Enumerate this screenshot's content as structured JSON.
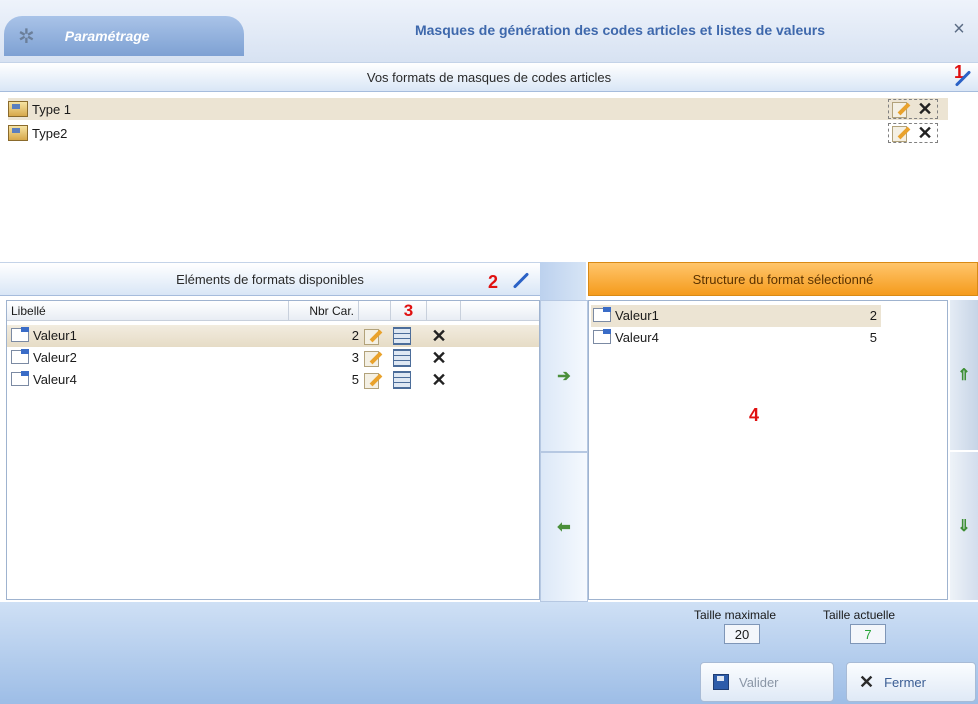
{
  "titlebar": {
    "tab_label": "Paramétrage",
    "title": "Masques de génération des codes articles et listes de valeurs",
    "close_glyph": "×"
  },
  "masks_section": {
    "header": "Vos formats de masques de codes articles",
    "marker": "1",
    "items": [
      {
        "label": "Type 1"
      },
      {
        "label": "Type2"
      }
    ]
  },
  "elements_section": {
    "header": "Eléments de formats disponibles",
    "marker": "2",
    "col_marker": "3",
    "columns": {
      "label": "Libellé",
      "count": "Nbr Car."
    },
    "rows": [
      {
        "label": "Valeur1",
        "count": "2"
      },
      {
        "label": "Valeur2",
        "count": "3"
      },
      {
        "label": "Valeur4",
        "count": "5"
      }
    ]
  },
  "structure_section": {
    "header": "Structure du format sélectionné",
    "marker": "4",
    "rows": [
      {
        "label": "Valeur1",
        "count": "2"
      },
      {
        "label": "Valeur4",
        "count": "5"
      }
    ]
  },
  "sizes": {
    "max_label": "Taille maximale",
    "max_value": "20",
    "current_label": "Taille actuelle",
    "current_value": "7"
  },
  "buttons": {
    "valider": "Valider",
    "fermer": "Fermer"
  },
  "icons": {
    "add_arrow": "➔",
    "remove_arrow": "⬅",
    "move_up": "⇑",
    "move_down": "⇓",
    "delete": "✕"
  },
  "colors": {
    "accent_orange": "#f59b1c",
    "title_blue": "#3e68ac",
    "current_size_green": "#27a53a",
    "marker_red": "#e01010"
  }
}
